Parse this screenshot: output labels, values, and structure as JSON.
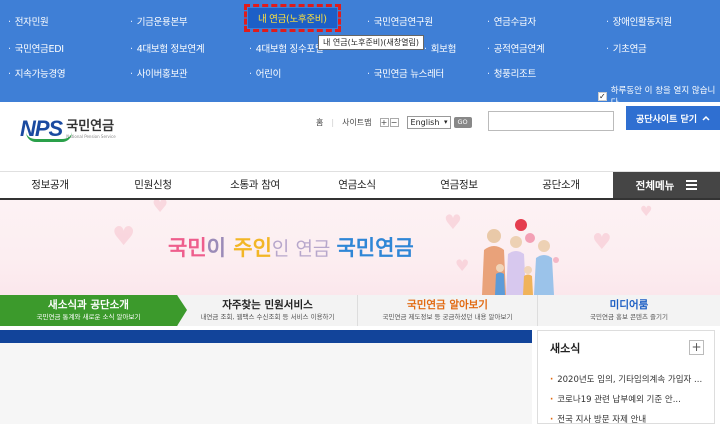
{
  "family_sites": {
    "row1": [
      "전자민원",
      "기금운용본부",
      "내 연금(노후준비)",
      "국민연금연구원",
      "연금수급자",
      "장애인활동지원"
    ],
    "row2": [
      "국민연금EDI",
      "4대보험 정보연계",
      "4대보험 징수포털",
      "회보험",
      "공적연금연계",
      "기초연금"
    ],
    "row3": [
      "지속가능경영",
      "사이버홍보관",
      "어린이",
      "국민연금 뉴스레터",
      "청풍리조트"
    ],
    "tooltip": "내 연금(노후준비)(새창열림)",
    "today_close_label": "하루동안 이 창을 열지 않습니다.",
    "today_close_checked": true
  },
  "header": {
    "logo_nps": "NPS",
    "logo_name": "국민연금",
    "logo_sub": "National Pension Service",
    "util_home": "홈",
    "util_sitemap": "사이트맵",
    "zoom_in": "+",
    "zoom_out": "−",
    "lang_value": "English",
    "go_label": "GO",
    "search_placeholder": "",
    "agency_site_close": "공단사이트 닫기",
    "agency_site_icon": "chevron-up-icon"
  },
  "gnb": {
    "items": [
      "정보공개",
      "민원신청",
      "소통과 참여",
      "연금소식",
      "연금정보",
      "공단소개"
    ],
    "all_menu": "전체메뉴"
  },
  "banner": {
    "slogan": {
      "p1": "국민",
      "p2": "이 ",
      "p3": "주인",
      "p4": "인 연금 ",
      "p5": "국민연금"
    }
  },
  "tabs": [
    {
      "title": "새소식과 공단소개",
      "sub": "국민연금 통계와 새로운 소식 알아보기"
    },
    {
      "title": "자주찾는 민원서비스",
      "sub": "내연금 조회, 웹팩스 수신조회 등 서비스 이용하기"
    },
    {
      "title": "국민연금 알아보기",
      "sub": "국민연금 제도정보 등 궁금하셨던 내용 알아보기"
    },
    {
      "title": "미디어룸",
      "sub": "국민연금 홍보 콘텐츠 즐기기"
    }
  ],
  "news": {
    "title": "새소식",
    "more_label": "+",
    "items": [
      "2020년도 임의, 기타임의계속 가입자 ...",
      "코로나19 관련 납부예외 기준 안...",
      "전국 지사 방문 자제 안내"
    ]
  },
  "colors": {
    "family_bg": "#3f7fd6",
    "highlight_bg": "#1c5fc7",
    "highlight_text": "#ffe23b",
    "highlight_border": "#e01c1c",
    "tab_active": "#3c9a2c",
    "tab_orange": "#e26a12",
    "tab_blue": "#1d5fc4",
    "dark_bar": "#12449a"
  }
}
